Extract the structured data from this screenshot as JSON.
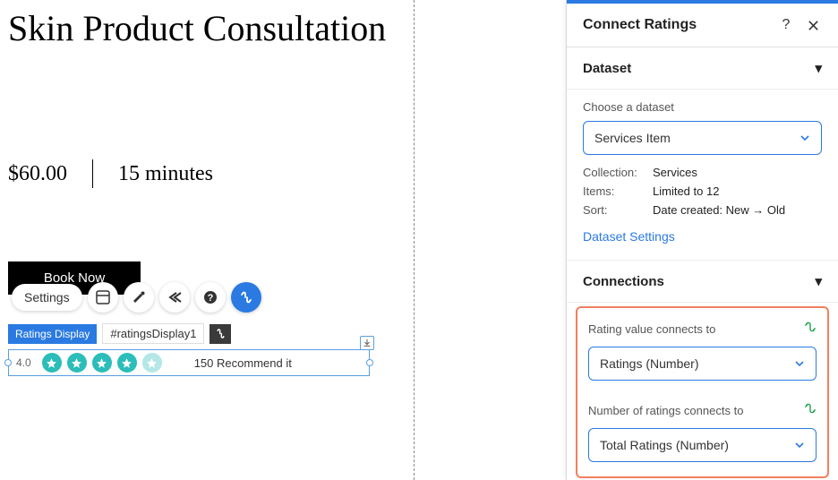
{
  "page": {
    "title": "Skin Product Consultation",
    "price": "$60.00",
    "duration": "15 minutes",
    "book_label": "Book Now"
  },
  "toolbar": {
    "settings_label": "Settings"
  },
  "element_tag": {
    "type_label": "Ratings Display",
    "id_label": "#ratingsDisplay1"
  },
  "ratings_widget": {
    "value": "4.0",
    "count": "150",
    "text": "Recommend it"
  },
  "panel": {
    "title": "Connect Ratings",
    "sections": {
      "dataset": {
        "heading": "Dataset",
        "choose_label": "Choose a dataset",
        "dataset_value": "Services Item",
        "meta": {
          "collection_k": "Collection:",
          "collection_v": "Services",
          "items_k": "Items:",
          "items_v": "Limited to 12",
          "sort_k": "Sort:",
          "sort_v": "Date created: New → Old"
        },
        "settings_link": "Dataset Settings"
      },
      "connections": {
        "heading": "Connections",
        "rating_value_label": "Rating value connects to",
        "rating_value_select": "Ratings (Number)",
        "num_ratings_label": "Number of ratings connects to",
        "num_ratings_select": "Total Ratings (Number)"
      }
    }
  }
}
